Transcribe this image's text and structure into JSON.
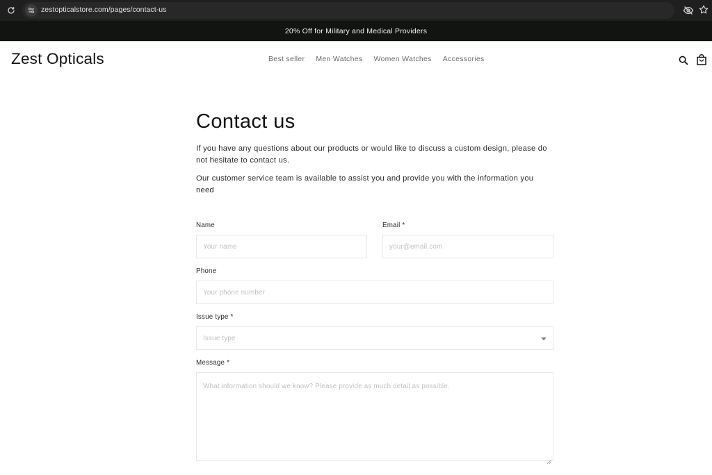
{
  "browser": {
    "url": "zestopticalstore.com/pages/contact-us",
    "icons": [
      "reload-icon",
      "site-info-icon",
      "eye-off-icon",
      "star-icon"
    ]
  },
  "announcement": {
    "text": "20% Off for Military and Medical Providers"
  },
  "header": {
    "logo": "Zest Opticals",
    "nav": [
      {
        "label": "Best seller"
      },
      {
        "label": "Men Watches"
      },
      {
        "label": "Women Watches"
      },
      {
        "label": "Accessories"
      }
    ],
    "icons": [
      "search-icon",
      "shopping-bag-icon"
    ]
  },
  "main": {
    "title": "Contact us",
    "intro": [
      "If you have any questions about our products or would like to discuss a custom design, please do not hesitate to contact us.",
      "Our customer service team is available to assist you and provide you with the information you need"
    ],
    "form": {
      "name": {
        "label": "Name",
        "placeholder": "Your name",
        "value": ""
      },
      "email": {
        "label": "Email *",
        "placeholder": "your@email.com",
        "value": ""
      },
      "phone": {
        "label": "Phone",
        "placeholder": "Your phone number",
        "value": ""
      },
      "issue_type": {
        "label": "Issue type *",
        "placeholder": "Issue type",
        "value": ""
      },
      "message": {
        "label": "Message *",
        "placeholder": "What information should we know? Please provide as much detail as possible.",
        "value": ""
      }
    }
  },
  "colors": {
    "announcement_bg": "#121412",
    "text": "#121212",
    "nav_text": "#6a6a6a",
    "field_border": "#e8e8e8",
    "placeholder": "#c0c0c0"
  }
}
